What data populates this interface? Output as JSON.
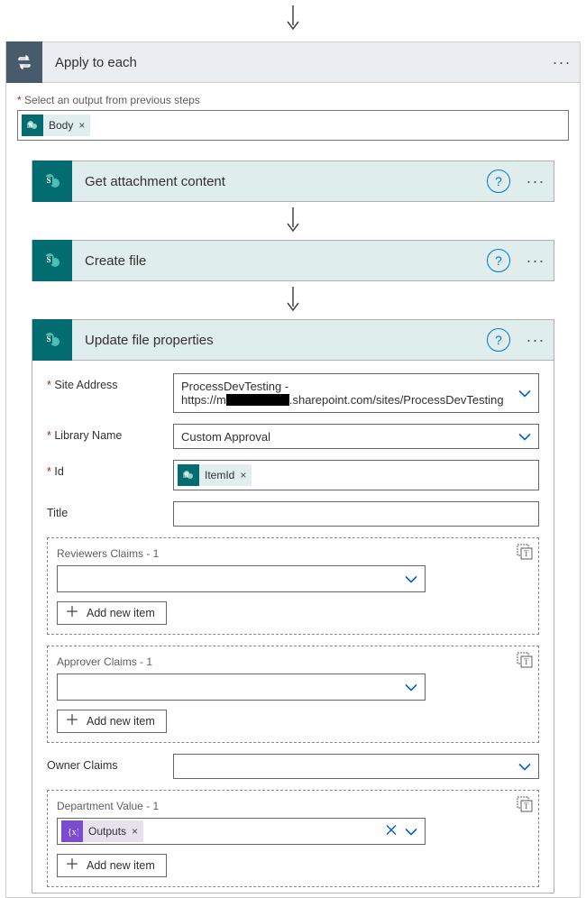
{
  "top": {
    "apply_to_each_label": "Apply to each",
    "select_output_label": "Select an output from previous steps",
    "body_token": "Body"
  },
  "actions": {
    "get_attachment": "Get attachment content",
    "create_file": "Create file",
    "update_file_props": "Update file properties"
  },
  "form": {
    "site_address_label": "Site Address",
    "site_address_line1": "ProcessDevTesting -",
    "site_address_prefix": "https://m",
    "site_address_suffix": ".sharepoint.com/sites/ProcessDevTesting",
    "library_name_label": "Library Name",
    "library_name_value": "Custom Approval",
    "id_label": "Id",
    "id_token": "ItemId",
    "title_label": "Title"
  },
  "groups": {
    "reviewers_label": "Reviewers Claims - 1",
    "approver_label": "Approver Claims - 1",
    "owner_label": "Owner Claims",
    "department_label": "Department Value - 1",
    "outputs_token": "Outputs",
    "add_new_item": "Add new item"
  }
}
